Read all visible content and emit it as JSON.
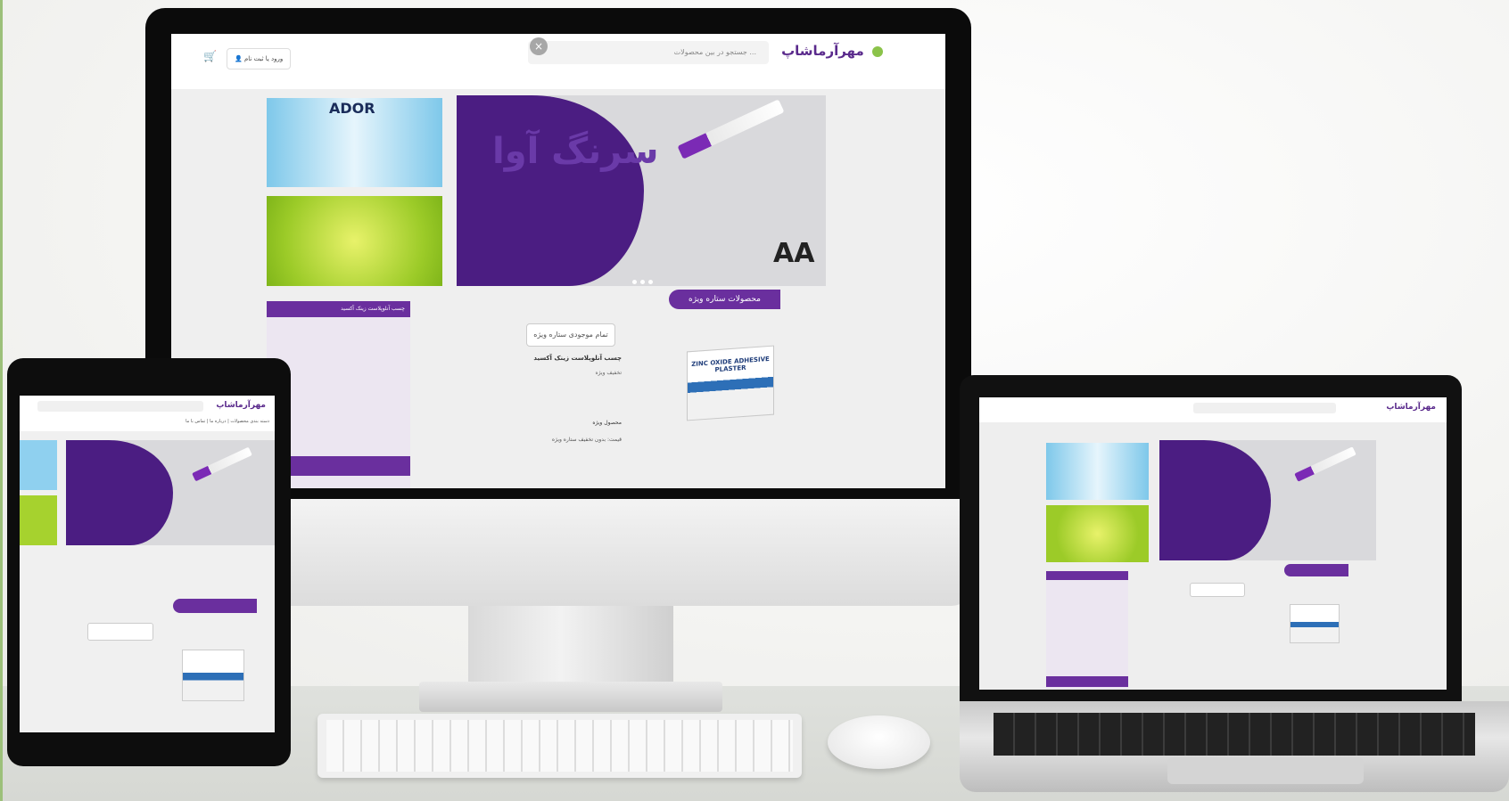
{
  "scene": {
    "description_colors": {
      "brand_purple": "#6a2f9e",
      "deep_purple": "#4b1d82",
      "accent_green": "#8bc34a"
    }
  },
  "monitor_site": {
    "logo": "مهرآرماشاپ",
    "search_placeholder": "جستجو در بین محصولات ...",
    "login_label": "ورود یا ثبت نام",
    "slider_text": "سرنگ آوا",
    "slider_brand": "AA",
    "banner_top_title": "ADOR",
    "special_tab": "محصولات ستاره ویژه",
    "special_button": "تمام موجودی ستاره ویژه",
    "product_title": "چسب آنلوپلاست زینک آکسید",
    "product_subtitle": "تخفیف ویژه",
    "product_box_text": "ZINC OXIDE ADHESIVE PLASTER",
    "price_label": "محصول ویژه",
    "price_sub": "قیمت: بدون تخفیف ستاره ویژه",
    "sidebar_head": "چسب آنلوپلاست زینک آکسید"
  },
  "tablet_site": {
    "logo": "مهرآرماشاپ",
    "nav": "دسته بندی محصولات | درباره ما | تماس با ما"
  },
  "laptop_site": {
    "logo": "مهرآرماشاپ"
  }
}
